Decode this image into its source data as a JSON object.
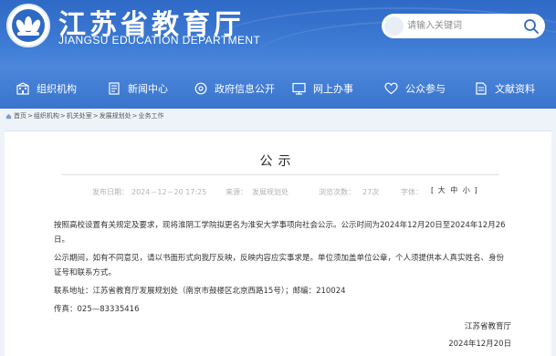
{
  "header": {
    "title": "江苏省教育厅",
    "subtitle": "JIANGSU EDUCATION DEPARTMENT",
    "search_placeholder": "请输入关键词",
    "logo_icon": "emblem-icon",
    "search_icon": "search-icon"
  },
  "nav": {
    "items": [
      {
        "label": "组织机构",
        "icon": "building-icon"
      },
      {
        "label": "新闻中心",
        "icon": "news-icon"
      },
      {
        "label": "政府信息公开",
        "icon": "info-disc-icon"
      },
      {
        "label": "网上办事",
        "icon": "monitor-icon"
      },
      {
        "label": "公众参与",
        "icon": "heart-icon"
      },
      {
        "label": "文献资料",
        "icon": "document-icon"
      }
    ]
  },
  "breadcrumb": {
    "items": [
      "首页",
      "组织机构",
      "机关处室",
      "发展规划处",
      "业务工作"
    ],
    "separator": ">"
  },
  "article": {
    "title": "公示",
    "meta": {
      "date_label": "发布日期：",
      "date": "2024－12－20 17:25",
      "source_label": "来源：",
      "source": "发展规划处",
      "views_label": "浏览次数：",
      "views": "27次",
      "font_label": "字体：",
      "font_open": "[",
      "font_large": "大",
      "font_medium": "中",
      "font_small": "小",
      "font_close": "]"
    },
    "paragraphs": [
      "按照高校设置有关规定及要求，现将淮阴工学院拟更名为淮安大学事项向社会公示。公示时间为2024年12月20日至2024年12月26日。",
      "公示期间，如有不同意见，请以书面形式向我厅反映，反映内容应实事求是。单位须加盖单位公章，个人须提供本人真实姓名、身份证号和联系方式。",
      "联系地址：江苏省教育厅发展规划处（南京市鼓楼区北京西路15号）；邮编：210024",
      "传真：025—83335416"
    ],
    "signature": "江苏省教育厅",
    "sign_date": "2024年12月20日"
  },
  "colors": {
    "header_blue": "#2f69c6",
    "nav_blue": "#3a74cd",
    "page_bg": "#eef3f9"
  }
}
